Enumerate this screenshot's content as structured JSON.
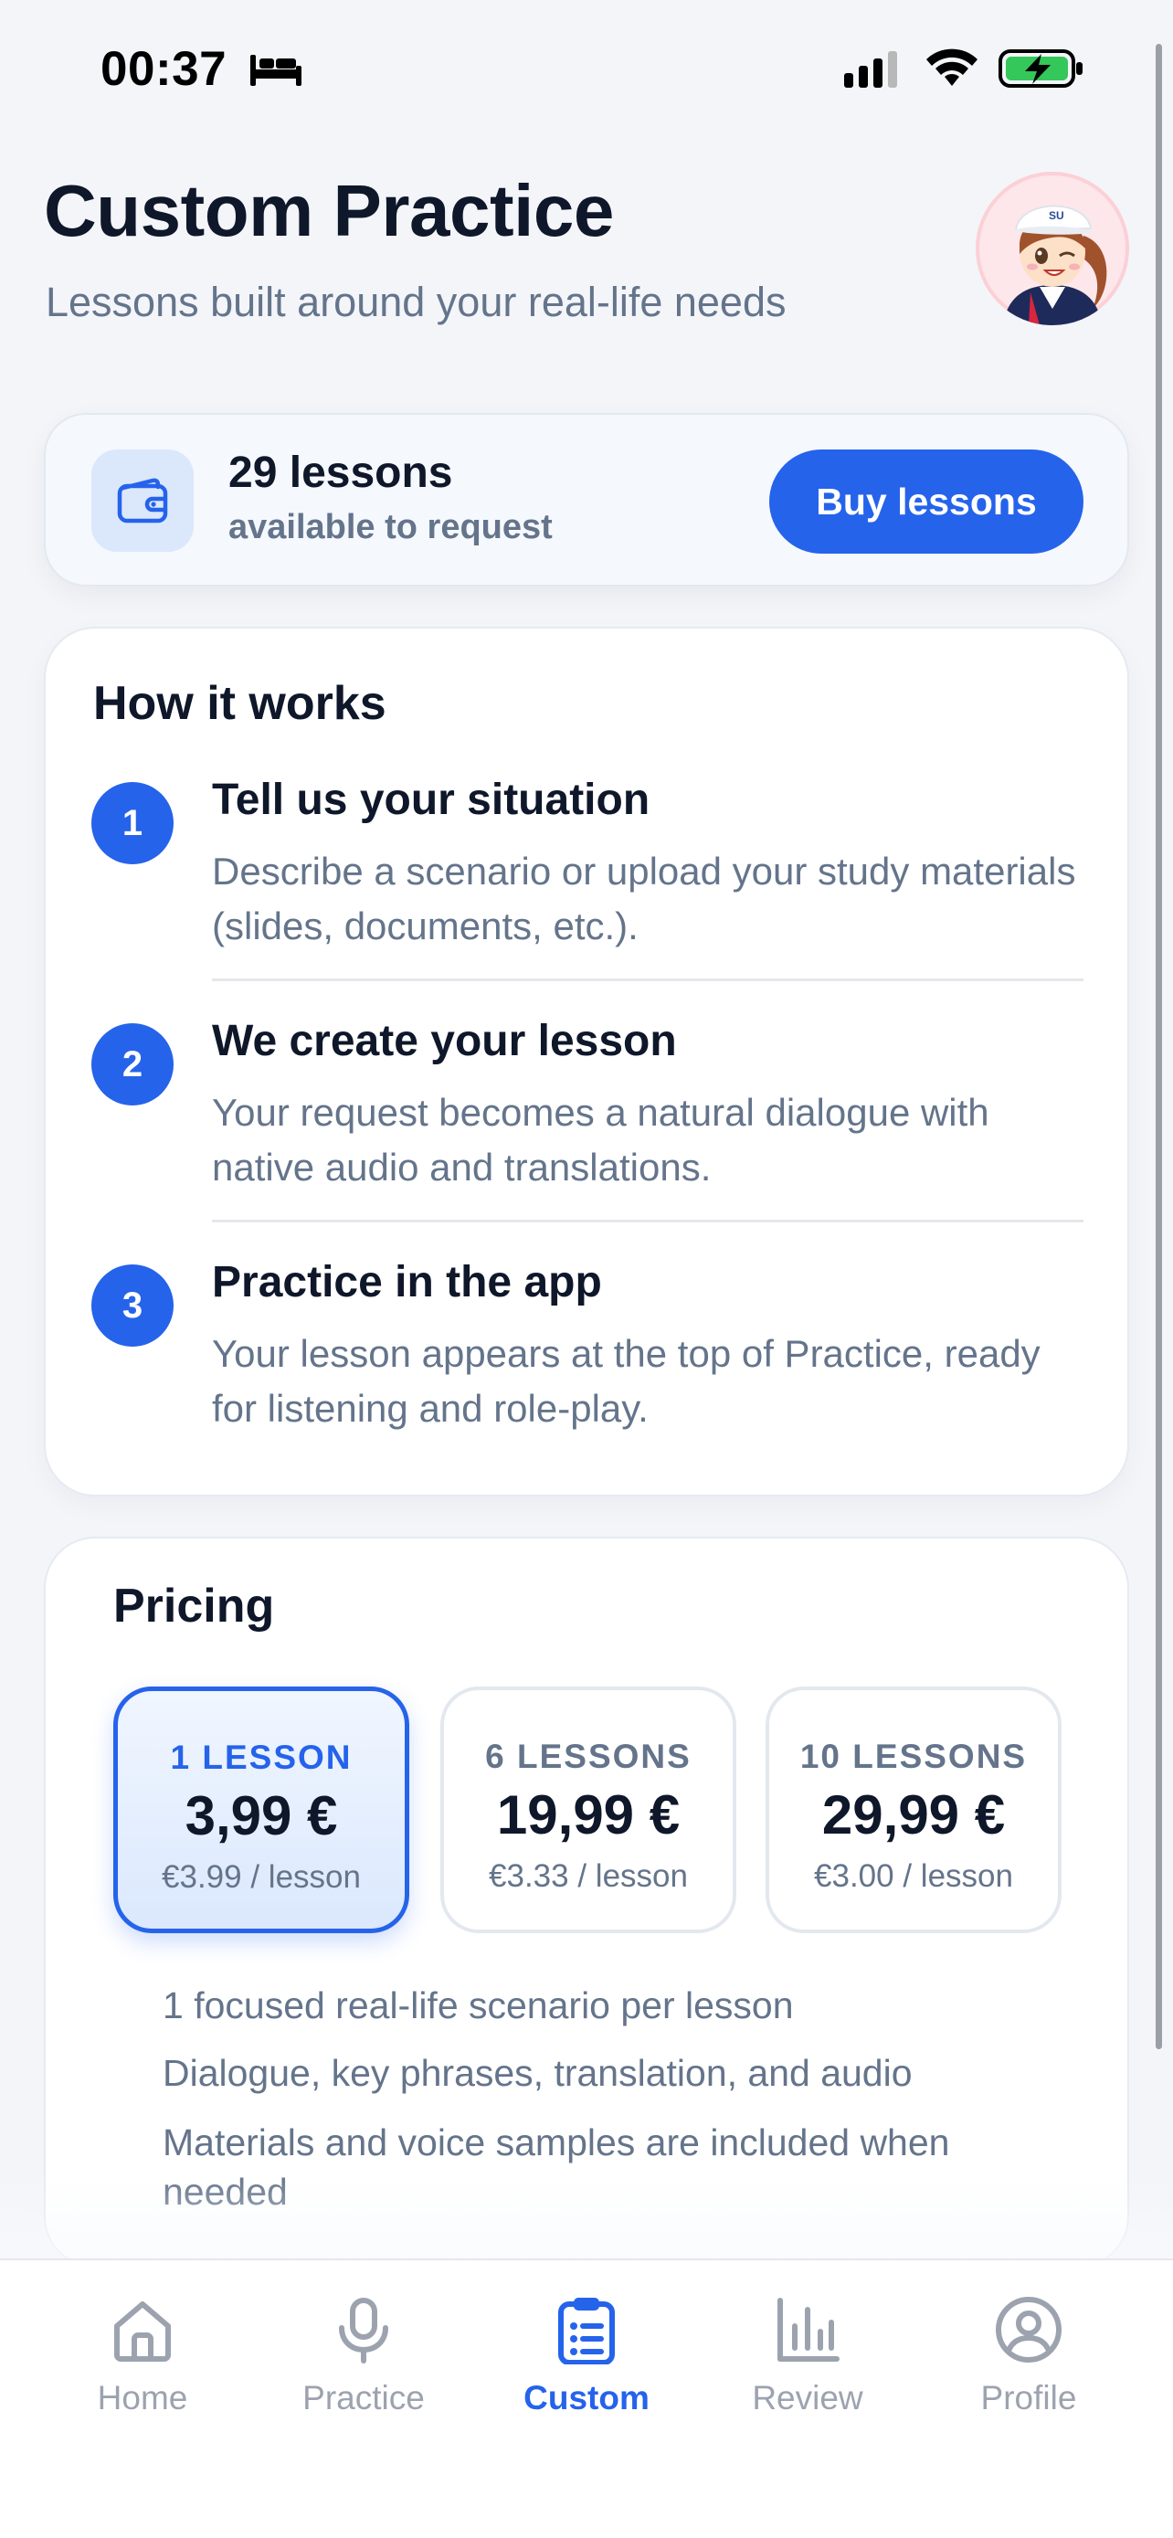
{
  "status_bar": {
    "time": "00:37",
    "icons": [
      "bed-icon",
      "cellular-signal-icon",
      "wifi-icon",
      "battery-charging-icon"
    ],
    "battery_color": "#34c759"
  },
  "header": {
    "title": "Custom Practice",
    "subtitle": "Lessons built around your real-life needs",
    "avatar_initials": "SU"
  },
  "lessons_card": {
    "icon": "wallet-icon",
    "count": "29 lessons",
    "caption": "available to request",
    "buy_button": "Buy lessons"
  },
  "how_it_works": {
    "title": "How it works",
    "steps": [
      {
        "number": "1",
        "title": "Tell us your situation",
        "description": "Describe a scenario or upload your study materials (slides, documents, etc.)."
      },
      {
        "number": "2",
        "title": "We create your lesson",
        "description": "Your request becomes a natural dialogue with native audio and translations."
      },
      {
        "number": "3",
        "title": "Practice in the app",
        "description": "Your lesson appears at the top of Practice, ready for listening and role-play."
      }
    ]
  },
  "pricing": {
    "title": "Pricing",
    "plans": [
      {
        "name": "1 LESSON",
        "price": "3,99 €",
        "per": "€3.99 / lesson",
        "selected": true
      },
      {
        "name": "6 LESSONS",
        "price": "19,99 €",
        "per": "€3.33 / lesson",
        "selected": false
      },
      {
        "name": "10 LESSONS",
        "price": "29,99 €",
        "per": "€3.00 / lesson",
        "selected": false
      }
    ],
    "features": [
      "1 focused real-life scenario per lesson",
      "Dialogue, key phrases, translation, and audio",
      "Materials and voice samples are included when needed"
    ]
  },
  "tab_bar": {
    "tabs": [
      {
        "label": "Home",
        "icon": "home-icon",
        "active": false
      },
      {
        "label": "Practice",
        "icon": "microphone-icon",
        "active": false
      },
      {
        "label": "Custom",
        "icon": "clipboard-list-icon",
        "active": true
      },
      {
        "label": "Review",
        "icon": "bar-chart-icon",
        "active": false
      },
      {
        "label": "Profile",
        "icon": "user-circle-icon",
        "active": false
      }
    ]
  },
  "colors": {
    "accent": "#2563eb",
    "text_primary": "#0f172a",
    "text_secondary": "#64748b",
    "inactive_tab": "#9ca3af",
    "background": "#f3f5f9"
  }
}
